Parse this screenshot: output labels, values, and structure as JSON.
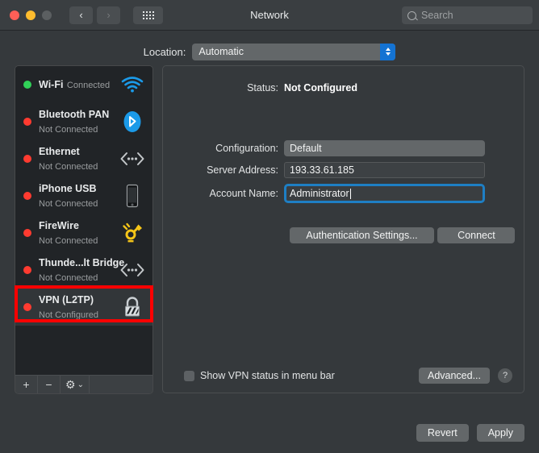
{
  "window": {
    "title": "Network",
    "traffic_lights": [
      "close",
      "minimize",
      "zoom"
    ],
    "back_label": "‹",
    "forward_label": "›",
    "grid_label": "show-all"
  },
  "search": {
    "placeholder": "Search",
    "value": ""
  },
  "location": {
    "label": "Location:",
    "selected": "Automatic",
    "options": [
      "Automatic"
    ]
  },
  "sidebar": {
    "services": [
      {
        "name": "Wi-Fi",
        "status": "Connected",
        "dot": "#31d158",
        "icon": "wifi-icon"
      },
      {
        "name": "Bluetooth PAN",
        "status": "Not Connected",
        "dot": "#ff3b30",
        "icon": "bluetooth-icon"
      },
      {
        "name": "Ethernet",
        "status": "Not Connected",
        "dot": "#ff3b30",
        "icon": "ethernet-icon"
      },
      {
        "name": "iPhone USB",
        "status": "Not Connected",
        "dot": "#ff3b30",
        "icon": "iphone-icon"
      },
      {
        "name": "FireWire",
        "status": "Not Connected",
        "dot": "#ff3b30",
        "icon": "firewire-icon"
      },
      {
        "name": "Thunde...lt Bridge",
        "status": "Not Connected",
        "dot": "#ff3b30",
        "icon": "ethernet-icon"
      },
      {
        "name": "VPN (L2TP)",
        "status": "Not Configured",
        "dot": "#ff3b30",
        "icon": "lock-icon"
      }
    ],
    "selected_index": 6,
    "toolbar": {
      "add_label": "+",
      "remove_label": "−",
      "action_label": "⚙",
      "action_chevron": "⌄"
    }
  },
  "details": {
    "status_label": "Status:",
    "status_value": "Not Configured",
    "configuration_label": "Configuration:",
    "configuration_value": "Default",
    "configuration_options": [
      "Default"
    ],
    "server_address_label": "Server Address:",
    "server_address_value": "193.33.61.185",
    "server_address_placeholder": "",
    "account_name_label": "Account Name:",
    "account_name_value": "Administrator",
    "account_name_placeholder": "",
    "auth_settings_label": "Authentication Settings...",
    "connect_label": "Connect",
    "show_status_label": "Show VPN status in menu bar",
    "show_status_checked": false,
    "advanced_label": "Advanced...",
    "help_label": "?"
  },
  "footer": {
    "revert_label": "Revert",
    "apply_label": "Apply"
  },
  "annotation": {
    "color": "#ff0000",
    "target": "VPN (L2TP)"
  }
}
